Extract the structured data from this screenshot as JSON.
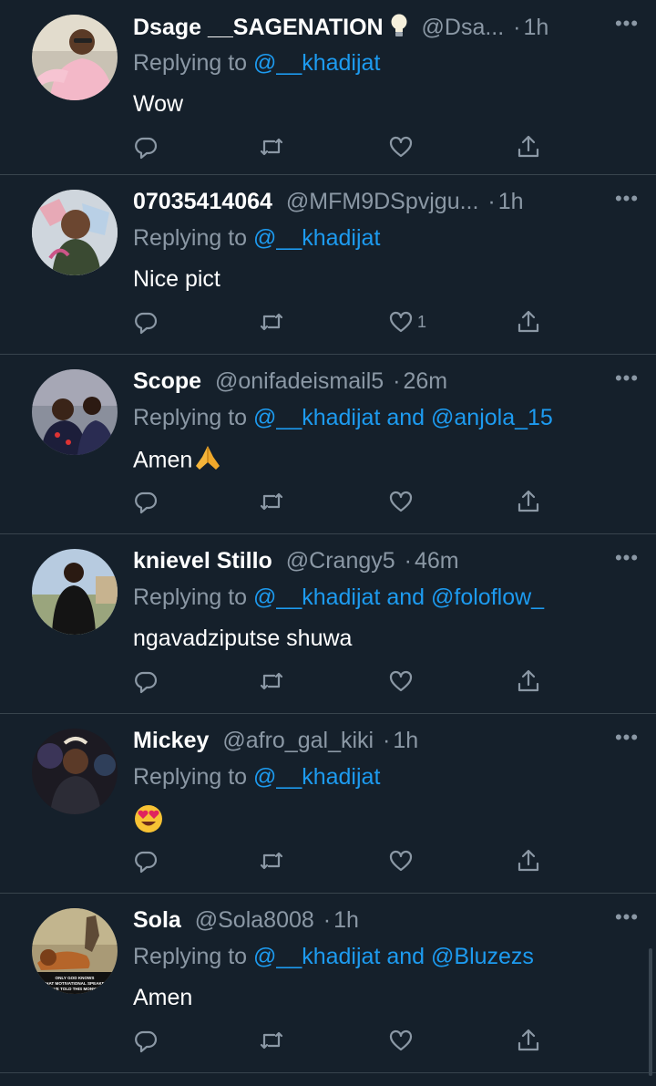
{
  "colors": {
    "background": "#15202b",
    "text_primary": "#ffffff",
    "text_secondary": "#8b98a5",
    "mention": "#1d9bf0",
    "divider": "#38444d"
  },
  "reply_prefix": "Replying to",
  "icons": {
    "reply": "reply-icon",
    "retweet": "retweet-icon",
    "like": "heart-icon",
    "share": "share-icon",
    "more": "more-options-icon"
  },
  "tweets": [
    {
      "name": "Dsage __SAGENATION",
      "name_emoji": "lightbulb",
      "handle": "@Dsa...",
      "time": "1h",
      "mentions": [
        "@__khadijat"
      ],
      "conjunction": "",
      "text": "Wow",
      "text_emoji": "",
      "like_count": ""
    },
    {
      "name": "07035414064",
      "name_emoji": "",
      "handle": "@MFM9DSpvjgu...",
      "time": "1h",
      "mentions": [
        "@__khadijat"
      ],
      "conjunction": "",
      "text": "Nice pict",
      "text_emoji": "",
      "like_count": "1"
    },
    {
      "name": "Scope",
      "name_emoji": "",
      "handle": "@onifadeismail5",
      "time": "26m",
      "mentions": [
        "@__khadijat",
        "@anjola_15"
      ],
      "conjunction": "and",
      "text": "Amen",
      "text_emoji": "folded-hands",
      "like_count": ""
    },
    {
      "name": "knievel Stillo",
      "name_emoji": "",
      "handle": "@Crangy5",
      "time": "46m",
      "mentions": [
        "@__khadijat",
        "@foloflow_"
      ],
      "conjunction": "and",
      "text": "ngavadziputse shuwa",
      "text_emoji": "",
      "like_count": ""
    },
    {
      "name": "Mickey",
      "name_emoji": "",
      "handle": "@afro_gal_kiki",
      "time": "1h",
      "mentions": [
        "@__khadijat"
      ],
      "conjunction": "",
      "text": "",
      "text_emoji": "heart-eyes",
      "like_count": ""
    },
    {
      "name": "Sola",
      "name_emoji": "",
      "handle": "@Sola8008",
      "time": "1h",
      "mentions": [
        "@__khadijat",
        "@Bluzezs"
      ],
      "conjunction": "and",
      "text": "Amen",
      "text_emoji": "",
      "like_count": "",
      "avatar_caption": "ONLY GOD KNOWS WHAT MOTIVATIONAL SPEAKER HAVE TOLD THIS MONKEY"
    }
  ]
}
